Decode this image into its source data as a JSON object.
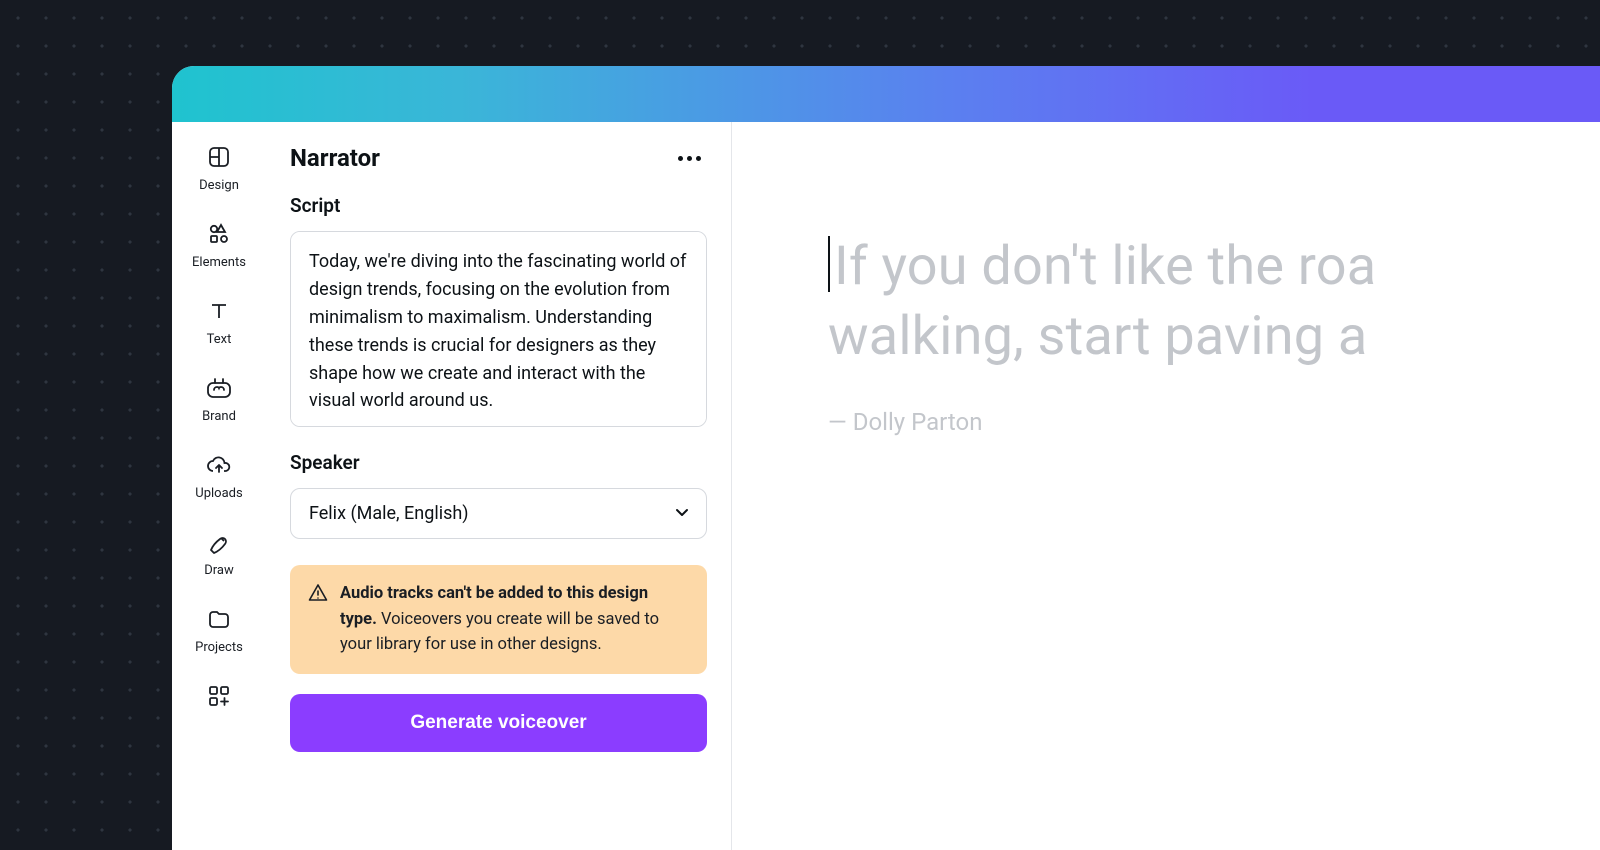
{
  "sidebar": {
    "items": [
      {
        "label": "Design",
        "icon": "template-icon"
      },
      {
        "label": "Elements",
        "icon": "shapes-icon"
      },
      {
        "label": "Text",
        "icon": "text-icon"
      },
      {
        "label": "Brand",
        "icon": "brand-icon"
      },
      {
        "label": "Uploads",
        "icon": "cloud-up-icon"
      },
      {
        "label": "Draw",
        "icon": "pencil-icon"
      },
      {
        "label": "Projects",
        "icon": "folder-icon"
      },
      {
        "label": "Apps",
        "icon": "apps-icon"
      }
    ]
  },
  "panel": {
    "title": "Narrator",
    "script_label": "Script",
    "script_value": "Today, we're diving into the fascinating world of design trends, focusing on the evolution from minimalism to maximalism. Understanding these trends is crucial for designers as they shape how we create and interact with the visual world around us.",
    "speaker_label": "Speaker",
    "speaker_value": "Felix (Male, English)",
    "warning_bold": "Audio tracks can't be added to this design type.",
    "warning_rest": " Voiceovers you create will be saved to your library for use in other designs.",
    "generate_label": "Generate voiceover"
  },
  "canvas": {
    "quote_line1": "If you don't like the roa",
    "quote_line2": "walking, start paving a",
    "attribution": "— Dolly Parton"
  }
}
